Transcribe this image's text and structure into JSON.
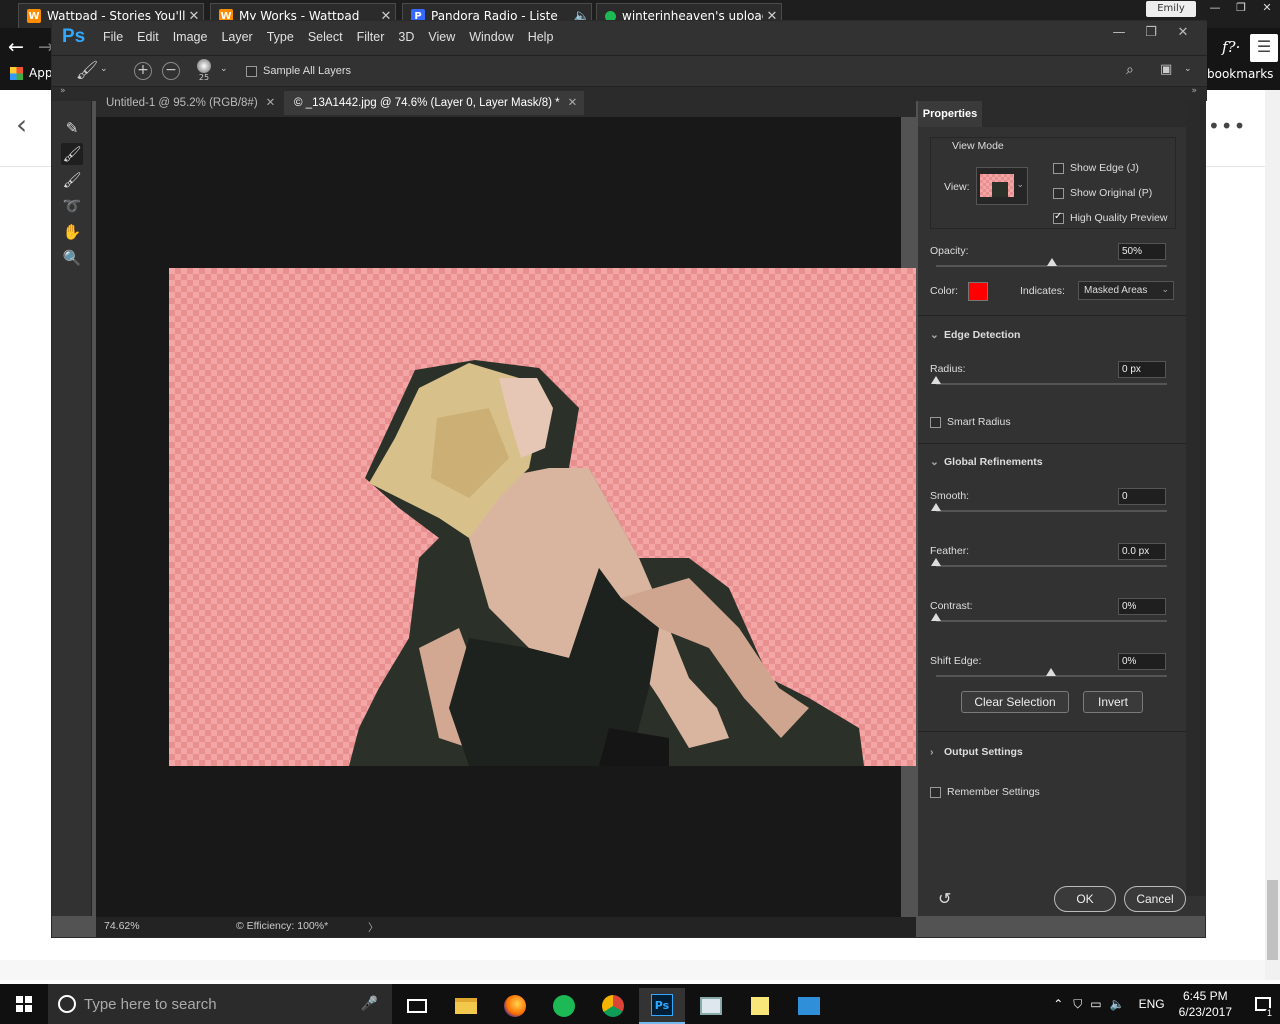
{
  "browser": {
    "tabs": [
      {
        "title": "Wattpad - Stories You'll L",
        "favicon": "wattpad-icon",
        "color": "#ff8c00"
      },
      {
        "title": "My Works - Wattpad",
        "favicon": "wattpad-icon",
        "color": "#ff8c00"
      },
      {
        "title": "Pandora Radio - Liste",
        "favicon": "pandora-icon",
        "color": "#3668ff"
      },
      {
        "title": "winterinheaven's upload",
        "favicon": "spotify-dot-icon",
        "color": "#1db954"
      }
    ],
    "user_name": "Emily",
    "apps_label": "Apps",
    "bookmarks_label": "bookmarks",
    "fx_label": "f?·"
  },
  "photoshop": {
    "logo": "Ps",
    "menu": [
      "File",
      "Edit",
      "Image",
      "Layer",
      "Type",
      "Select",
      "Filter",
      "3D",
      "View",
      "Window",
      "Help"
    ],
    "options": {
      "brush_size": "25",
      "sample_all_layers": "Sample All Layers"
    },
    "doc_tabs": [
      {
        "title": "Untitled-1 @ 95.2% (RGB/8#)",
        "active": false
      },
      {
        "title": "© _13A1442.jpg @ 74.6% (Layer 0, Layer Mask/8) *",
        "active": true
      }
    ],
    "status": {
      "zoom": "74.62%",
      "efficiency": "© Efficiency: 100%*"
    },
    "properties": {
      "tab_label": "Properties",
      "view_mode_title": "View Mode",
      "view_label": "View:",
      "show_edge": "Show Edge (J)",
      "show_original": "Show Original (P)",
      "high_quality": "High Quality Preview",
      "high_quality_checked": true,
      "opacity_label": "Opacity:",
      "opacity_value": "50%",
      "opacity_level": 0.5,
      "color_label": "Color:",
      "overlay_color": "#ff0000",
      "indicates_label": "Indicates:",
      "indicates_value": "Masked Areas",
      "edge_detection": "Edge Detection",
      "radius_label": "Radius:",
      "radius_value": "0 px",
      "smart_radius": "Smart Radius",
      "global_refinements": "Global Refinements",
      "smooth_label": "Smooth:",
      "smooth_value": "0",
      "feather_label": "Feather:",
      "feather_value": "0.0 px",
      "contrast_label": "Contrast:",
      "contrast_value": "0%",
      "shift_edge_label": "Shift Edge:",
      "shift_edge_value": "0%",
      "clear_selection": "Clear Selection",
      "invert": "Invert",
      "output_settings": "Output Settings",
      "remember_settings": "Remember Settings",
      "ok": "OK",
      "cancel": "Cancel"
    }
  },
  "taskbar": {
    "search_placeholder": "Type here to search",
    "language": "ENG",
    "time": "6:45 PM",
    "date": "6/23/2017",
    "notification_count": "1"
  }
}
